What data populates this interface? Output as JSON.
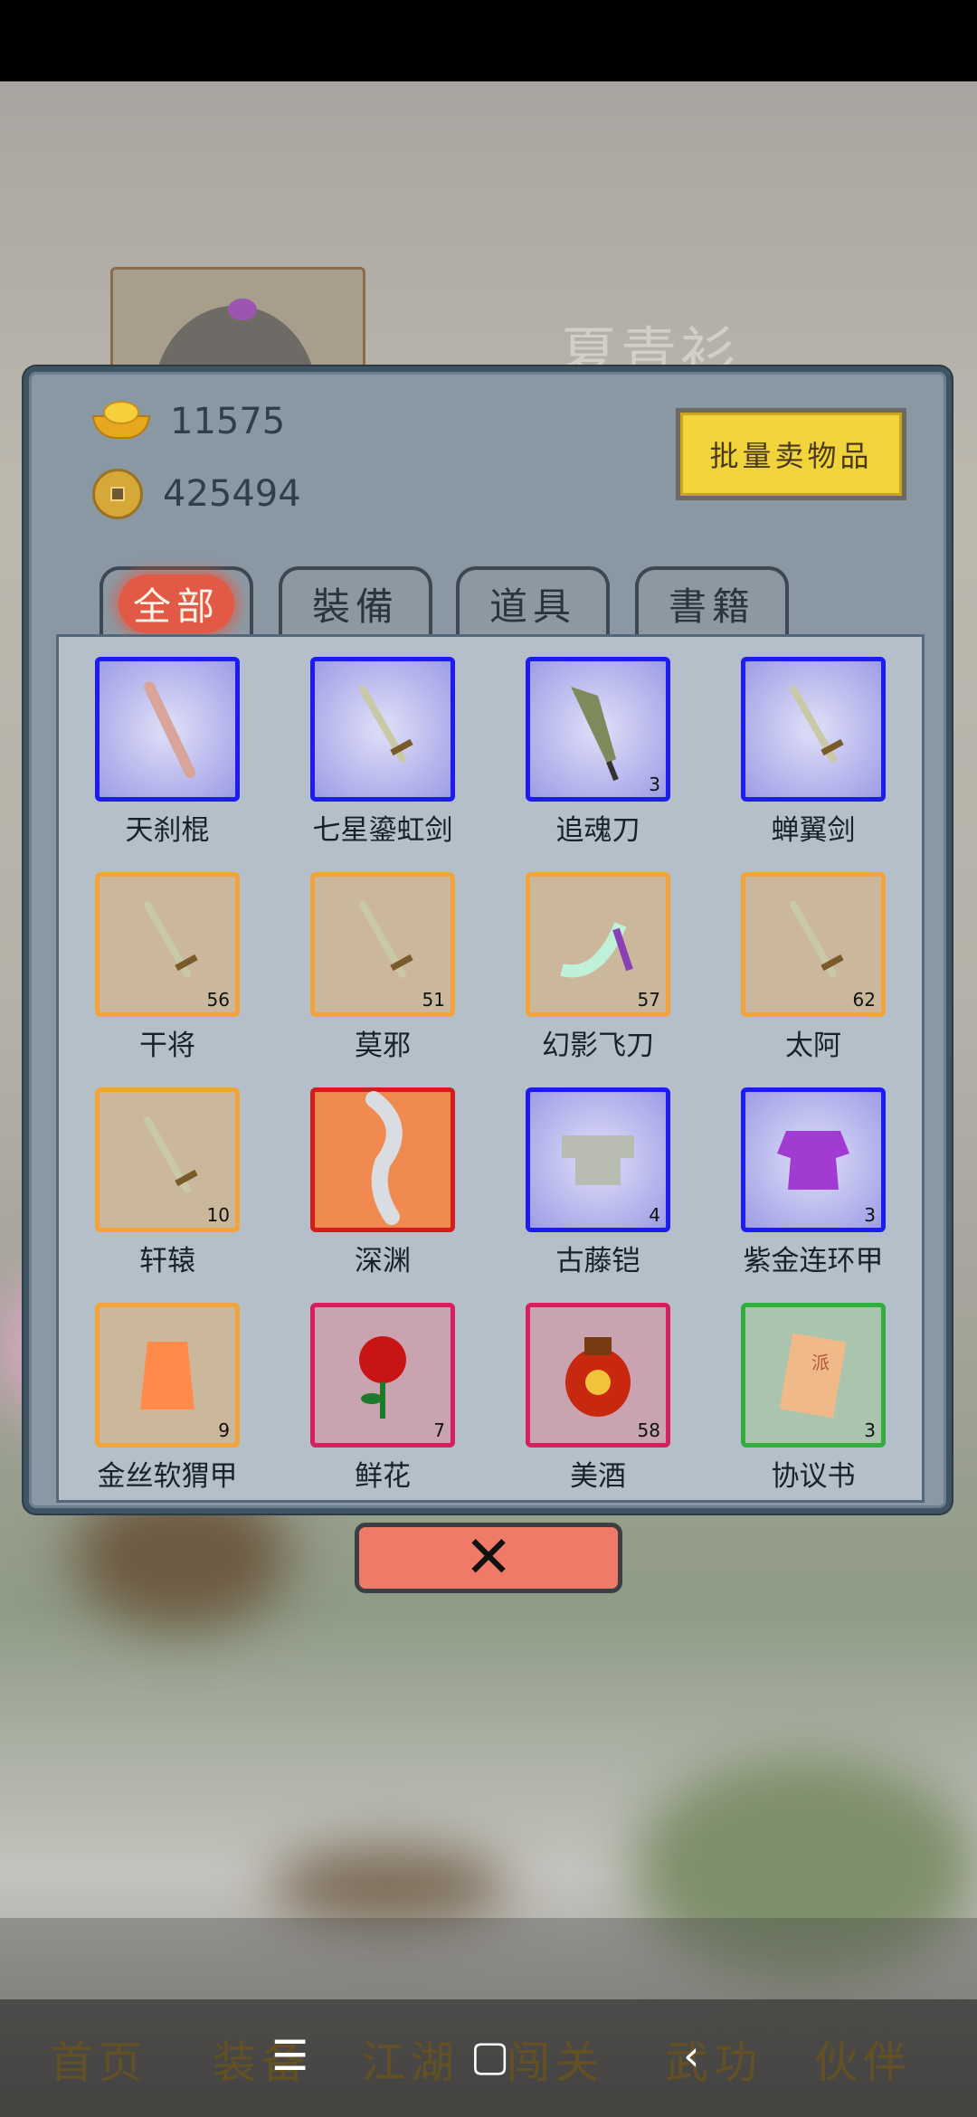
{
  "character": {
    "name": "夏青衫"
  },
  "currency": {
    "gold_ingots": "11575",
    "copper_coins": "425494"
  },
  "bulk_sell_label": "批量卖物品",
  "tabs": [
    "全部",
    "裝備",
    "道具",
    "書籍"
  ],
  "items": [
    {
      "name": "天刹棍",
      "qty": "",
      "rarity": "blue",
      "icon": "staff-icon"
    },
    {
      "name": "七星鎏虹剑",
      "qty": "",
      "rarity": "blue",
      "icon": "sword-icon"
    },
    {
      "name": "追魂刀",
      "qty": "3",
      "rarity": "blue",
      "icon": "broadsword-icon"
    },
    {
      "name": "蝉翼剑",
      "qty": "",
      "rarity": "blue",
      "icon": "sword-icon"
    },
    {
      "name": "干将",
      "qty": "56",
      "rarity": "orange",
      "icon": "sword-icon"
    },
    {
      "name": "莫邪",
      "qty": "51",
      "rarity": "orange",
      "icon": "sword-icon"
    },
    {
      "name": "幻影飞刀",
      "qty": "57",
      "rarity": "orange",
      "icon": "dagger-icon"
    },
    {
      "name": "太阿",
      "qty": "62",
      "rarity": "orange",
      "icon": "sword-icon"
    },
    {
      "name": "轩辕",
      "qty": "10",
      "rarity": "orange",
      "icon": "sword-icon"
    },
    {
      "name": "深渊",
      "qty": "",
      "rarity": "red",
      "icon": "curved-blade-icon"
    },
    {
      "name": "古藤铠",
      "qty": "4",
      "rarity": "blue",
      "icon": "armor-icon"
    },
    {
      "name": "紫金连环甲",
      "qty": "3",
      "rarity": "blue",
      "icon": "robe-icon"
    },
    {
      "name": "金丝软猬甲",
      "qty": "9",
      "rarity": "orange",
      "icon": "vest-icon"
    },
    {
      "name": "鲜花",
      "qty": "7",
      "rarity": "pink",
      "icon": "rose-icon"
    },
    {
      "name": "美酒",
      "qty": "58",
      "rarity": "pink",
      "icon": "wine-jar-icon"
    },
    {
      "name": "协议书",
      "qty": "3",
      "rarity": "green",
      "icon": "scroll-icon"
    }
  ],
  "close_label": "✕",
  "bottom_nav": [
    "首页",
    "装备",
    "江湖",
    "闯关",
    "武功",
    "伙伴"
  ],
  "system_nav": {
    "menu": "☰",
    "home": "▢",
    "back": "‹"
  }
}
